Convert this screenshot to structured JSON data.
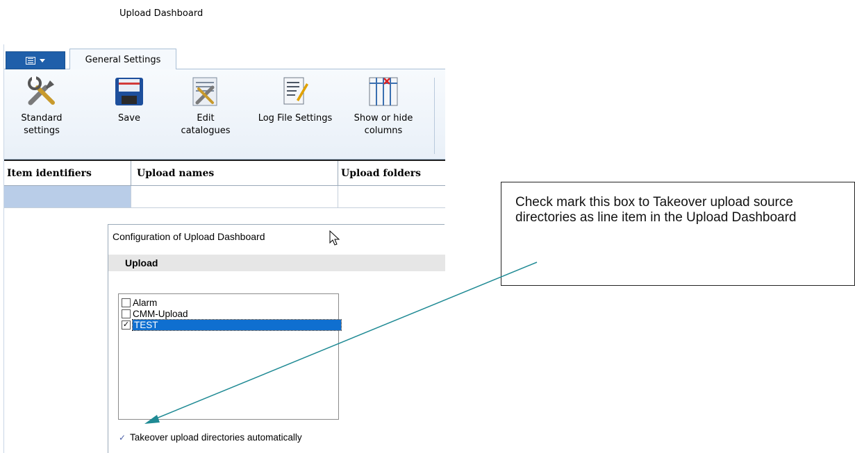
{
  "doc_title": "Upload Dashboard",
  "ribbon": {
    "tab_label": "General Settings",
    "buttons": [
      {
        "label": "Standard settings",
        "icon": "tools-icon"
      },
      {
        "label": "Save",
        "icon": "floppy-disk-icon"
      },
      {
        "label": "Edit catalogues",
        "icon": "catalogue-icon"
      },
      {
        "label": "Log File Settings",
        "icon": "log-file-icon"
      },
      {
        "label": "Show or hide columns",
        "icon": "columns-icon"
      }
    ]
  },
  "grid": {
    "columns": [
      "Item identifiers",
      "Upload names",
      "Upload folders"
    ]
  },
  "dialog": {
    "title": "Configuration of Upload Dashboard",
    "section": "Upload",
    "items": [
      {
        "label": "Alarm",
        "checked": false,
        "selected": false
      },
      {
        "label": "CMM-Upload",
        "checked": false,
        "selected": false
      },
      {
        "label": "TEST",
        "checked": true,
        "selected": true
      }
    ],
    "auto_label": "Takeover upload directories automatically",
    "auto_checked": true
  },
  "callout": {
    "text": "Check mark this box to Takeover upload source directories as line item in the Upload Dashboard"
  },
  "colors": {
    "accent": "#1f5faa",
    "selection": "#0f6fd0",
    "arrow": "#1f8a94",
    "grid_selected_cell": "#b9cde8"
  }
}
